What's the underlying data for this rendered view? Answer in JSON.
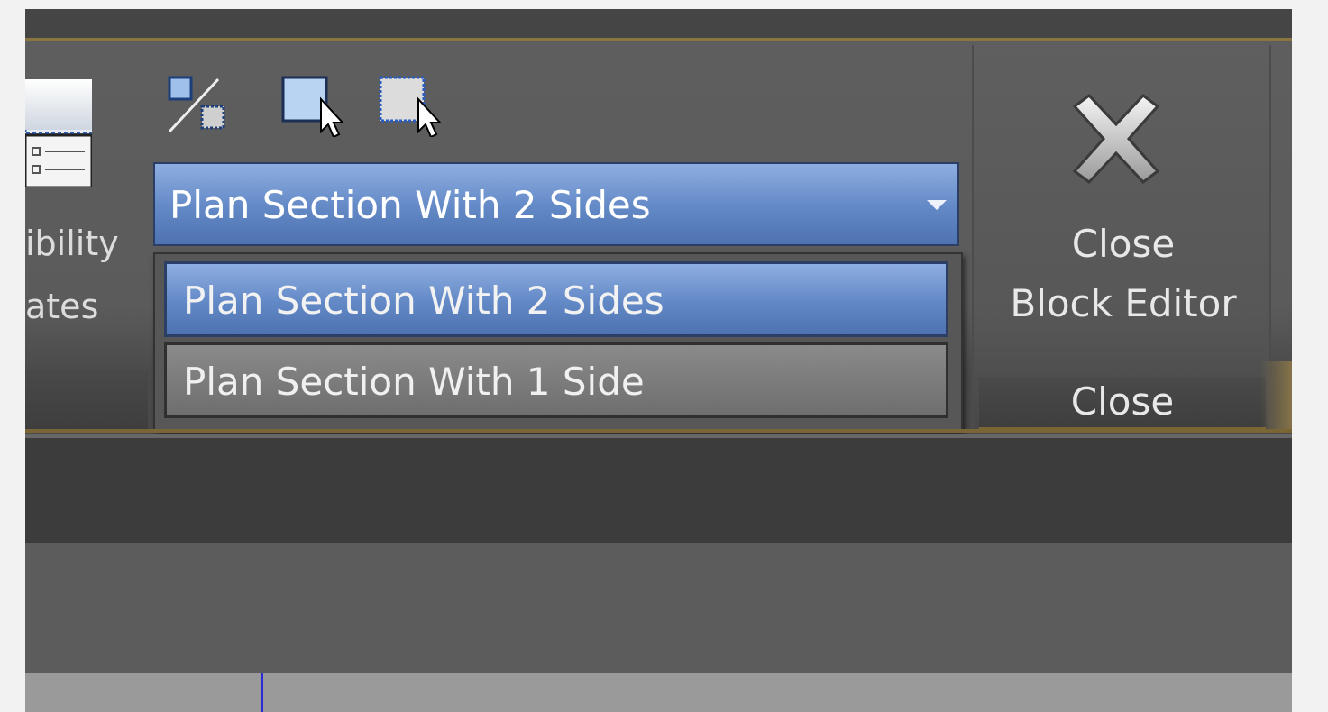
{
  "ribbon": {
    "visibility_states": {
      "label_line1": "ibility",
      "label_line2": "ates"
    },
    "small_tools": [
      {
        "icon": "visibility-mode-icon"
      },
      {
        "icon": "make-visible-icon"
      },
      {
        "icon": "make-invisible-icon"
      }
    ],
    "visibility_state_dropdown": {
      "selected": "Plan Section With 2 Sides",
      "options": [
        "Plan Section With 2 Sides",
        "Plan Section With 1 Side"
      ]
    },
    "close_panel": {
      "button_line1": "Close",
      "button_line2": "Block Editor",
      "group_label": "Close"
    }
  },
  "colors": {
    "accent_selected": "#6288c6",
    "ribbon_bg": "#5b5b5b",
    "panel_border_gold": "#8a7440",
    "cursor_line": "#2b2bd6"
  }
}
